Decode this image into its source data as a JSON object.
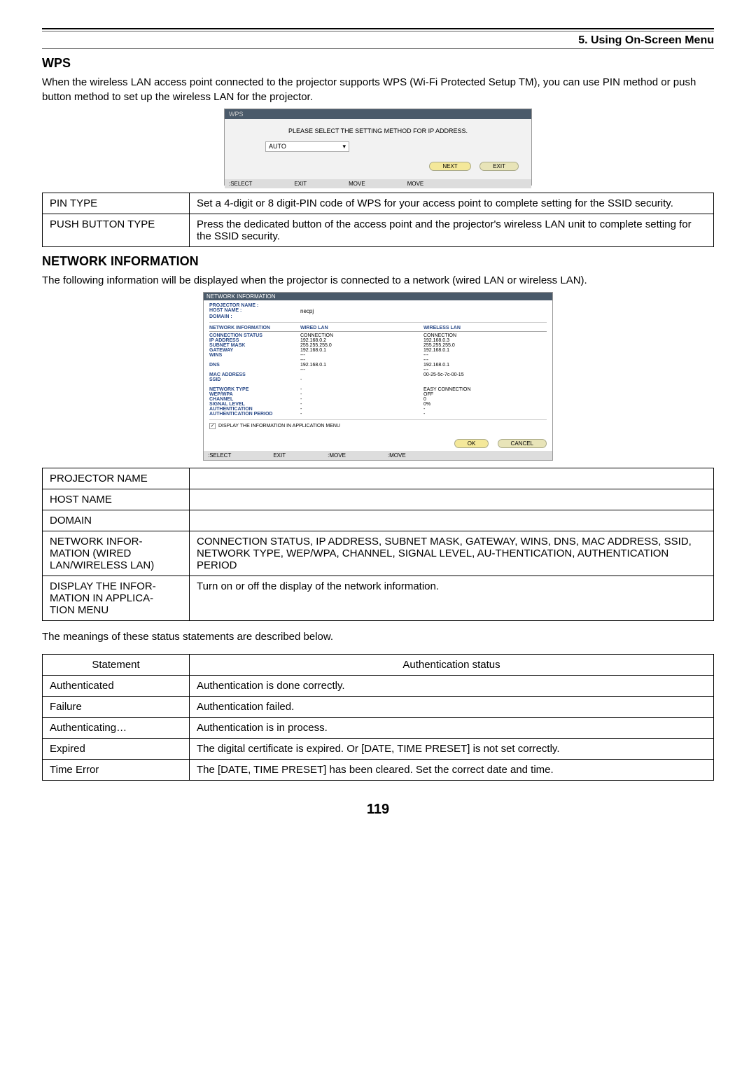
{
  "chapter": "5. Using On-Screen Menu",
  "wps": {
    "title": "WPS",
    "intro": "When the wireless LAN access point connected to the projector supports WPS (Wi-Fi Protected Setup TM), you can use PIN method or push button method to set up the wireless LAN for the projector.",
    "shot": {
      "header": "WPS",
      "instruction": "PLEASE SELECT THE SETTING METHOD FOR IP ADDRESS.",
      "mode": "AUTO",
      "next": "NEXT",
      "exit": "EXIT",
      "footer_select": ":SELECT",
      "footer_exit": "EXIT",
      "footer_move1": "MOVE",
      "footer_move2": "MOVE"
    },
    "table": [
      {
        "k": "PIN TYPE",
        "v": "Set a 4-digit or 8 digit-PIN code of WPS for your access point to complete setting for the SSID security."
      },
      {
        "k": "PUSH BUTTON TYPE",
        "v": "Press the dedicated button of the access point and the projector's wireless LAN unit to complete setting for the SSID security."
      }
    ]
  },
  "netinfo": {
    "title": "NETWORK INFORMATION",
    "intro": "The following information will be displayed when the projector is connected to a network (wired LAN or wireless LAN).",
    "shot": {
      "header": "NETWORK INFORMATION",
      "projector_name_label": "PROJECTOR NAME :",
      "host_name_label": "HOST NAME :",
      "host_name": "necpj",
      "domain_label": "DOMAIN :",
      "section_label": "NETWORK INFORMATION",
      "wired_col": "WIRED LAN",
      "wireless_col": "WIRELESS LAN",
      "rows_labels": [
        "CONNECTION STATUS",
        "IP ADDRESS",
        "SUBNET MASK",
        "GATEWAY",
        "WINS",
        "",
        "DNS",
        "",
        "MAC ADDRESS",
        "SSID",
        "",
        "NETWORK TYPE",
        "WEP/WPA",
        "CHANNEL",
        "SIGNAL LEVEL",
        "AUTHENTICATION",
        "AUTHENTICATION PERIOD"
      ],
      "wired_vals": [
        "CONNECTION",
        "192.168.0.2",
        "255.255.255.0",
        "192.168.0.1",
        "---",
        "---",
        "192.168.0.1",
        "---",
        "",
        "-",
        "",
        "-",
        "-",
        "-",
        "-",
        "-",
        "-"
      ],
      "wireless_vals": [
        "CONNECTION",
        "192.168.0.3",
        "255.255.255.0",
        "192.168.0.1",
        "---",
        "---",
        "192.168.0.1",
        "---",
        "00-25-5c-7c-00-15",
        "",
        "",
        "EASY CONNECTION",
        "OFF",
        "0",
        "0%",
        "-",
        "-"
      ],
      "checkbox_label": "DISPLAY THE INFORMATION IN APPLICATION MENU",
      "ok": "OK",
      "cancel": "CANCEL",
      "footer_select": ":SELECT",
      "footer_exit": "EXIT",
      "footer_move1": ":MOVE",
      "footer_move2": ":MOVE"
    },
    "table": [
      {
        "k": "PROJECTOR NAME",
        "v": ""
      },
      {
        "k": "HOST NAME",
        "v": ""
      },
      {
        "k": "DOMAIN",
        "v": ""
      },
      {
        "k": "NETWORK INFOR-\nMATION (WIRED LAN/WIRELESS LAN)",
        "v": "CONNECTION STATUS, IP ADDRESS, SUBNET MASK, GATEWAY, WINS, DNS, MAC ADDRESS, SSID, NETWORK TYPE, WEP/WPA, CHANNEL, SIGNAL LEVEL, AU-THENTICATION, AUTHENTICATION PERIOD"
      },
      {
        "k": "DISPLAY THE INFOR-\nMATION IN APPLICA-\nTION MENU",
        "v": "Turn on or off the display of the network information."
      }
    ],
    "note": "The meanings of these status statements are described below.",
    "status_header": {
      "k": "Statement",
      "v": "Authentication status"
    },
    "status_rows": [
      {
        "k": "Authenticated",
        "v": "Authentication is done correctly."
      },
      {
        "k": "Failure",
        "v": "Authentication failed."
      },
      {
        "k": "Authenticating…",
        "v": "Authentication is in process."
      },
      {
        "k": "Expired",
        "v": "The digital certificate is expired. Or [DATE, TIME PRESET] is not set correctly."
      },
      {
        "k": "Time Error",
        "v": "The [DATE, TIME PRESET] has been cleared. Set the correct date and time."
      }
    ]
  },
  "page_number": "119"
}
